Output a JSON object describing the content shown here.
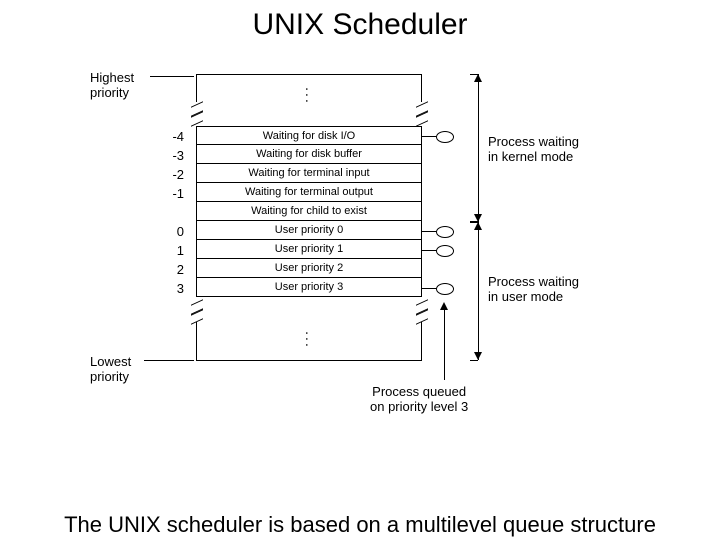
{
  "title": "UNIX Scheduler",
  "caption": "The UNIX scheduler is based on a multilevel queue structure",
  "highest_label": "Highest\npriority",
  "lowest_label": "Lowest\npriority",
  "kernel_label": "Process waiting\nin kernel mode",
  "user_label": "Process waiting\nin user mode",
  "queued_label": "Process queued\non priority level 3",
  "rows": [
    {
      "num": "-4",
      "text": "Waiting for disk I/O",
      "node": true
    },
    {
      "num": "-3",
      "text": "Waiting for disk buffer",
      "node": false
    },
    {
      "num": "-2",
      "text": "Waiting for terminal input",
      "node": false
    },
    {
      "num": "-1",
      "text": "Waiting for terminal output",
      "node": false
    },
    {
      "num": "",
      "text": "Waiting for child to exist",
      "node": false
    },
    {
      "num": "0",
      "text": "User priority 0",
      "node": true
    },
    {
      "num": "1",
      "text": "User priority 1",
      "node": true
    },
    {
      "num": "2",
      "text": "User priority 2",
      "node": false
    },
    {
      "num": "3",
      "text": "User priority 3",
      "node": true
    }
  ]
}
